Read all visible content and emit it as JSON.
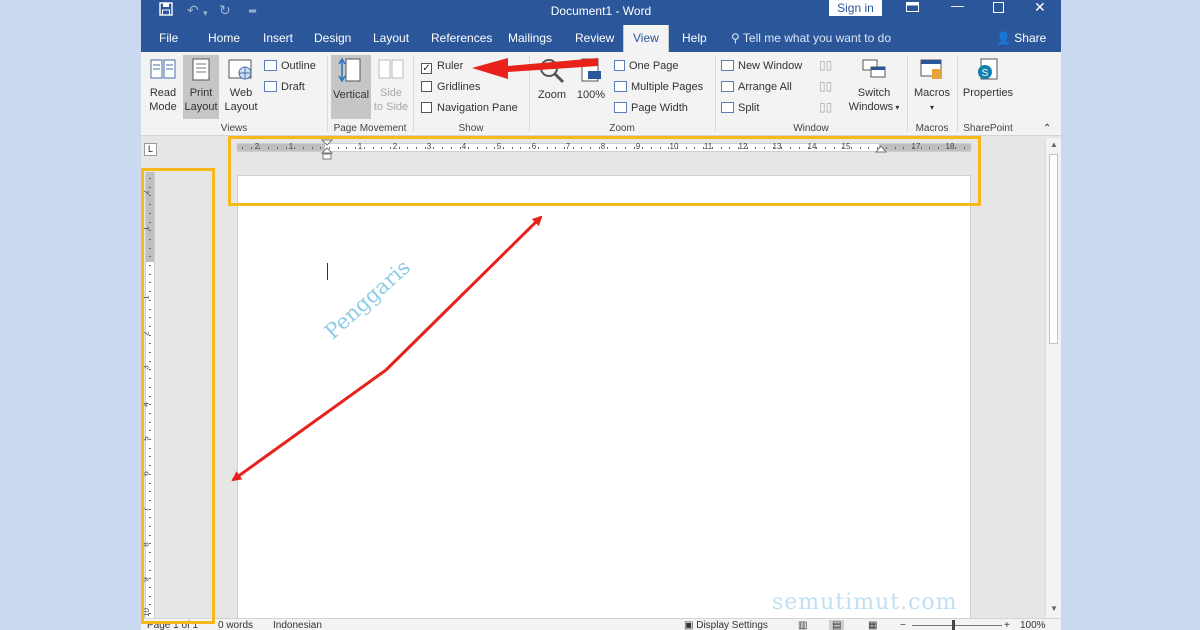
{
  "title_bar": {
    "document_title": "Document1 - Word",
    "sign_in_label": "Sign in",
    "qa_icons": [
      "save-icon",
      "undo-icon",
      "redo-icon",
      "customize-qat-icon"
    ],
    "window_controls": [
      "ribbon-display-icon",
      "minimize-icon",
      "maximize-icon",
      "close-icon"
    ]
  },
  "tabs": {
    "items": [
      "File",
      "Home",
      "Insert",
      "Design",
      "Layout",
      "References",
      "Mailings",
      "Review",
      "View",
      "Help"
    ],
    "active": "View",
    "tell_me": "Tell me what you want to do",
    "share": "Share"
  },
  "ribbon": {
    "views": {
      "group_label": "Views",
      "read_mode": [
        "Read",
        "Mode"
      ],
      "print_layout": [
        "Print",
        "Layout"
      ],
      "web_layout": [
        "Web",
        "Layout"
      ],
      "outline": "Outline",
      "draft": "Draft"
    },
    "page_movement": {
      "group_label": "Page Movement",
      "vertical": "Vertical",
      "side_to_side": [
        "Side",
        "to Side"
      ]
    },
    "show": {
      "group_label": "Show",
      "ruler": "Ruler",
      "gridlines": "Gridlines",
      "navigation_pane": "Navigation Pane",
      "ruler_checked": true,
      "gridlines_checked": false,
      "navigation_pane_checked": false
    },
    "zoom": {
      "group_label": "Zoom",
      "zoom": "Zoom",
      "hundred": "100%",
      "one_page": "One Page",
      "multiple_pages": "Multiple Pages",
      "page_width": "Page Width"
    },
    "window": {
      "group_label": "Window",
      "new_window": "New Window",
      "arrange_all": "Arrange All",
      "split": "Split",
      "switch_windows": [
        "Switch",
        "Windows"
      ]
    },
    "macros": {
      "group_label": "Macros",
      "macros": "Macros"
    },
    "sharepoint": {
      "group_label": "SharePoint",
      "properties": "Properties"
    }
  },
  "horizontal_ruler": {
    "numbers": [
      "2",
      "1",
      "1",
      "2",
      "3",
      "4",
      "5",
      "6",
      "7",
      "8",
      "9",
      "10",
      "11",
      "12",
      "13",
      "14",
      "15",
      "17",
      "18"
    ]
  },
  "vertical_ruler": {
    "numbers": [
      "2",
      "1",
      "1",
      "2",
      "3",
      "4",
      "5",
      "6",
      "7",
      "8",
      "9",
      "10"
    ]
  },
  "status_bar": {
    "page": "Page 1 of 1",
    "words": "0 words",
    "language": "Indonesian",
    "display_settings": "Display Settings",
    "zoom": "100%"
  },
  "annotations": {
    "label": "Penggaris",
    "watermark": "semutimut.com"
  },
  "colors": {
    "accent": "#2b579a",
    "highlight": "#f6b81b",
    "arrow": "#e8221b"
  }
}
